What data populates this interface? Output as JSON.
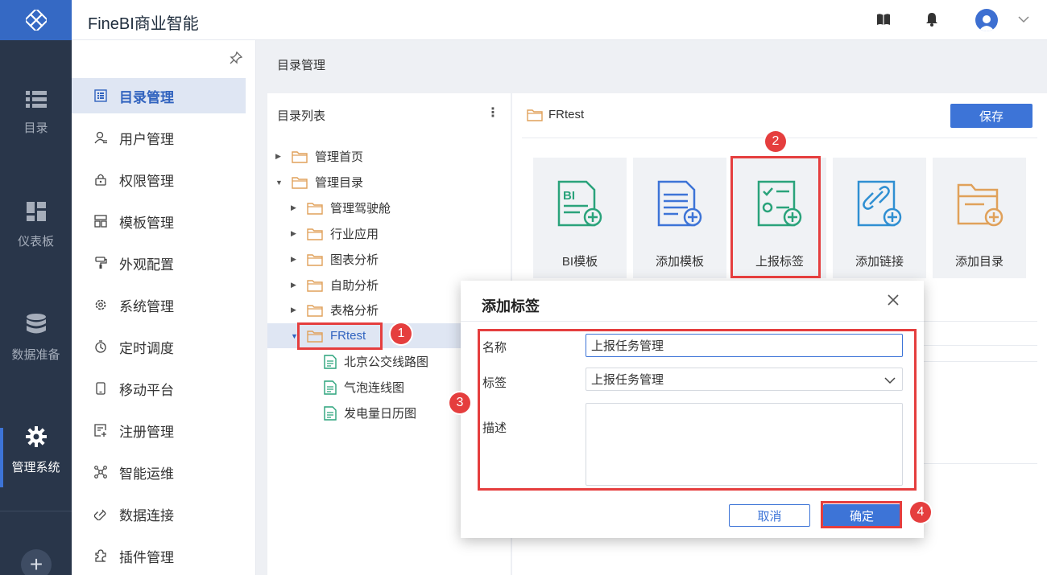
{
  "app": {
    "title": "FineBI商业智能"
  },
  "rail": {
    "items": [
      {
        "label": "目录",
        "icon": "list-icon"
      },
      {
        "label": "仪表板",
        "icon": "dashboard-icon"
      },
      {
        "label": "数据准备",
        "icon": "database-icon"
      },
      {
        "label": "管理系统",
        "icon": "gear-icon",
        "active": true
      }
    ],
    "add_label": "+"
  },
  "subnav": {
    "items": [
      {
        "label": "目录管理",
        "icon": "catalog-icon",
        "active": true
      },
      {
        "label": "用户管理",
        "icon": "user-icon"
      },
      {
        "label": "权限管理",
        "icon": "lock-icon"
      },
      {
        "label": "模板管理",
        "icon": "template-icon"
      },
      {
        "label": "外观配置",
        "icon": "brush-icon"
      },
      {
        "label": "系统管理",
        "icon": "settings-icon"
      },
      {
        "label": "定时调度",
        "icon": "timer-icon"
      },
      {
        "label": "移动平台",
        "icon": "mobile-icon"
      },
      {
        "label": "注册管理",
        "icon": "register-icon"
      },
      {
        "label": "智能运维",
        "icon": "ops-icon"
      },
      {
        "label": "数据连接",
        "icon": "link-icon"
      },
      {
        "label": "插件管理",
        "icon": "plugin-icon"
      }
    ]
  },
  "main": {
    "breadcrumb": "目录管理",
    "list": {
      "title": "目录列表",
      "more": "⋮",
      "tree": [
        {
          "label": "管理首页",
          "type": "folder",
          "expanded": false
        },
        {
          "label": "管理目录",
          "type": "folder",
          "expanded": true
        },
        {
          "label": "管理驾驶舱",
          "type": "folder",
          "expanded": false
        },
        {
          "label": "行业应用",
          "type": "folder",
          "expanded": false
        },
        {
          "label": "图表分析",
          "type": "folder",
          "expanded": false
        },
        {
          "label": "自助分析",
          "type": "folder",
          "expanded": false
        },
        {
          "label": "表格分析",
          "type": "folder",
          "expanded": false
        },
        {
          "label": "FRtest",
          "type": "folder",
          "expanded": true,
          "selected": true
        },
        {
          "label": "北京公交线路图",
          "type": "file"
        },
        {
          "label": "气泡连线图",
          "type": "file"
        },
        {
          "label": "发电量日历图",
          "type": "file"
        }
      ]
    },
    "detail": {
      "folder_name": "FRtest",
      "save_label": "保存",
      "cards": [
        {
          "label": "BI模板",
          "icon": "bi-template-icon"
        },
        {
          "label": "添加模板",
          "icon": "add-template-icon"
        },
        {
          "label": "上报标签",
          "icon": "report-tag-icon"
        },
        {
          "label": "添加链接",
          "icon": "add-link-icon"
        },
        {
          "label": "添加目录",
          "icon": "add-folder-icon"
        }
      ]
    }
  },
  "dialog": {
    "title": "添加标签",
    "name_label": "名称",
    "name_value": "上报任务管理",
    "tag_label": "标签",
    "tag_value": "上报任务管理",
    "desc_label": "描述",
    "desc_value": "",
    "cancel_label": "取消",
    "ok_label": "确定"
  },
  "annotations": [
    "1",
    "2",
    "3",
    "4"
  ],
  "colors": {
    "accent": "#3d74d7",
    "rail_bg": "#29364a",
    "highlight": "#e53e3e",
    "folder": "#e0a15a",
    "file": "#2aa37b"
  }
}
